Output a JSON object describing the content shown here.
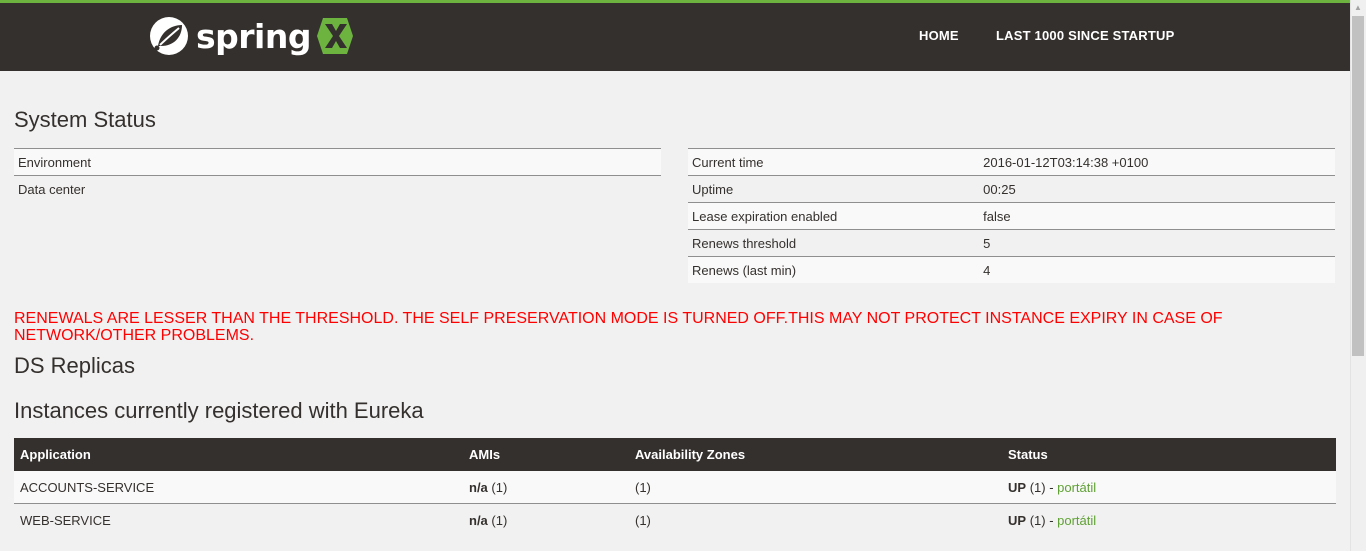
{
  "nav": {
    "brand": "spring",
    "links": [
      "HOME",
      "LAST 1000 SINCE STARTUP"
    ]
  },
  "system_status": {
    "title": "System Status",
    "left": [
      {
        "label": "Environment",
        "value": ""
      },
      {
        "label": "Data center",
        "value": ""
      }
    ],
    "right": [
      {
        "label": "Current time",
        "value": "2016-01-12T03:14:38 +0100"
      },
      {
        "label": "Uptime",
        "value": "00:25"
      },
      {
        "label": "Lease expiration enabled",
        "value": "false"
      },
      {
        "label": "Renews threshold",
        "value": "5"
      },
      {
        "label": "Renews (last min)",
        "value": "4"
      }
    ]
  },
  "warning": "RENEWALS ARE LESSER THAN THE THRESHOLD. THE SELF PRESERVATION MODE IS TURNED OFF.THIS MAY NOT PROTECT INSTANCE EXPIRY IN CASE OF NETWORK/OTHER PROBLEMS.",
  "replicas_title": "DS Replicas",
  "instances": {
    "title": "Instances currently registered with Eureka",
    "headers": [
      "Application",
      "AMIs",
      "Availability Zones",
      "Status"
    ],
    "rows": [
      {
        "application": "ACCOUNTS-SERVICE",
        "amis_value": "n/a",
        "amis_count": "(1)",
        "zones": "(1)",
        "status": "UP",
        "status_count": "(1) - ",
        "instance_link": "portátil"
      },
      {
        "application": "WEB-SERVICE",
        "amis_value": "n/a",
        "amis_count": "(1)",
        "zones": "(1)",
        "status": "UP",
        "status_count": "(1) - ",
        "instance_link": "portátil"
      }
    ]
  },
  "colors": {
    "navbar": "#34302d",
    "accent": "#6db33f",
    "warning": "#ff0000",
    "link": "#5fa134"
  },
  "icons": [
    "spring-leaf-icon",
    "spring-x-icon"
  ]
}
